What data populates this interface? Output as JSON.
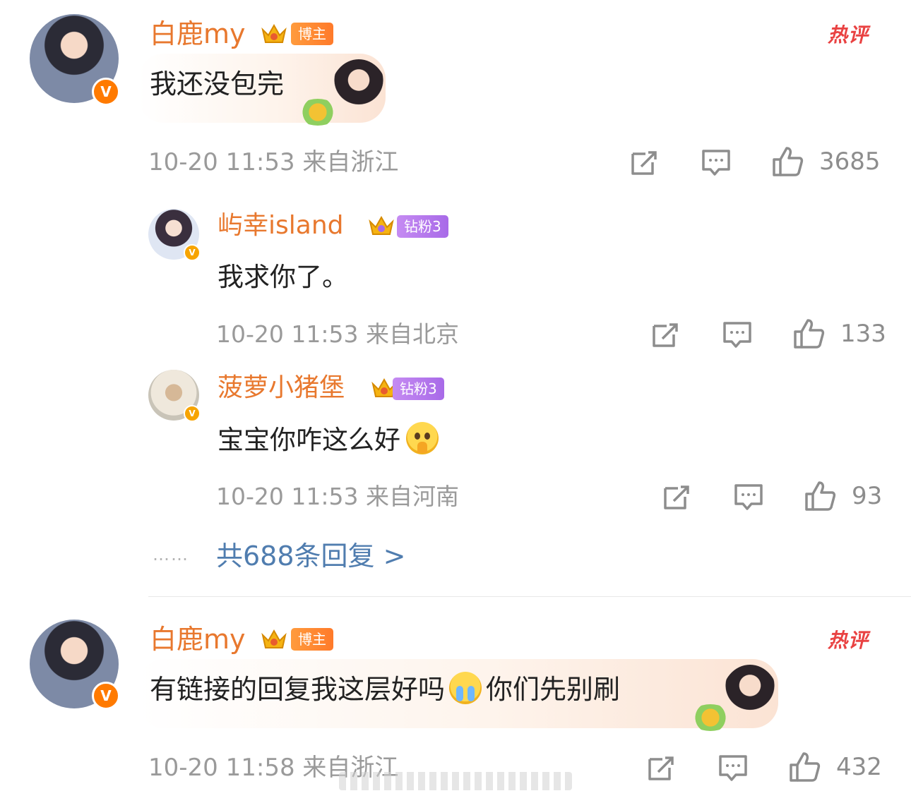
{
  "comments": [
    {
      "username": "白鹿my",
      "tag": "博主",
      "hot_label": "热评",
      "text": "我还没包完",
      "time": "10-20 11:53",
      "location": "来自浙江",
      "likes": "3685",
      "replies": [
        {
          "username": "屿幸island",
          "tag": "钻粉3",
          "text": "我求你了。",
          "time": "10-20 11:53",
          "location": "来自北京",
          "likes": "133"
        },
        {
          "username": "菠萝小猪堡",
          "tag": "钻粉3",
          "text": "宝宝你咋这么好",
          "emoji": "pleading-face-emoji",
          "time": "10-20 11:53",
          "location": "来自河南",
          "likes": "93"
        }
      ],
      "more_dots": "……",
      "more_replies": "共688条回复 >"
    },
    {
      "username": "白鹿my",
      "tag": "博主",
      "hot_label": "热评",
      "text_before": "有链接的回复我这层好吗",
      "emoji": "crying-face-emoji",
      "text_after": "你们先别刷",
      "time": "10-20 11:58",
      "location": "来自浙江",
      "likes": "432"
    }
  ],
  "colors": {
    "username": "#e8782e",
    "link": "#507daf",
    "meta": "#9a9a9a",
    "hot": "#e94242"
  }
}
